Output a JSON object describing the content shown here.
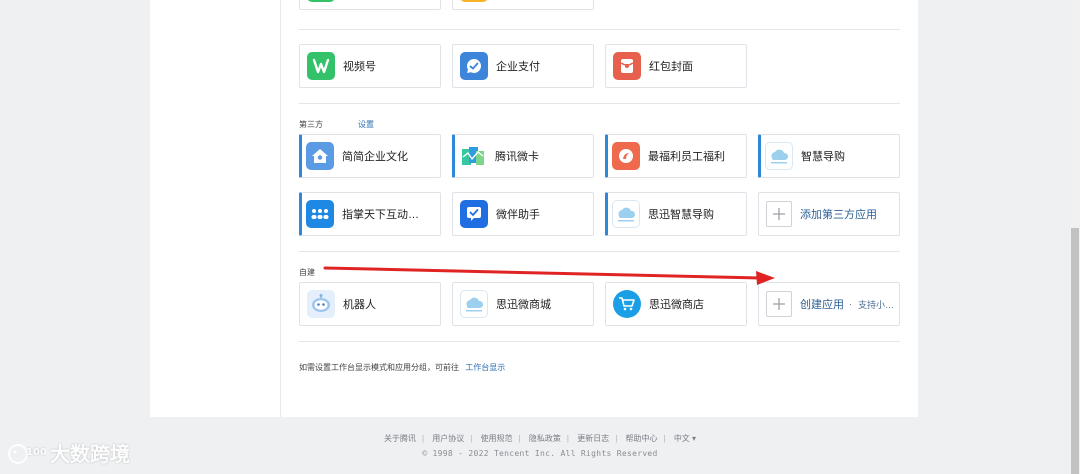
{
  "sections": {
    "row_top": {
      "items": [
        {
          "label": "视频号",
          "icon": "channels-icon",
          "color": "#33c26a"
        },
        {
          "label": "企业支付",
          "icon": "payment-icon",
          "color": "#3d85da"
        },
        {
          "label": "红包封面",
          "icon": "red-packet-icon",
          "color": "#e6604d"
        }
      ]
    },
    "third_party": {
      "title": "第三方",
      "settings_link": "设置",
      "items": [
        {
          "label": "简简企业文化",
          "icon": "house-icon",
          "color": "#5a9be3"
        },
        {
          "label": "腾讯微卡",
          "icon": "card-icon",
          "color": "#37c7a2"
        },
        {
          "label": "最福利员工福利",
          "icon": "welfare-icon",
          "color": "#ef6a4d"
        },
        {
          "label": "智慧导购",
          "icon": "cloud-shop-icon",
          "color": "#67b6e3"
        },
        {
          "label": "指掌天下互动…",
          "icon": "people-icon",
          "color": "#1e88e5"
        },
        {
          "label": "微伴助手",
          "icon": "check-chat-icon",
          "color": "#1f6fe3"
        },
        {
          "label": "思迅智慧导购",
          "icon": "cloud-shop-icon",
          "color": "#67b6e3"
        }
      ],
      "add_label": "添加第三方应用"
    },
    "custom": {
      "title": "自建",
      "items": [
        {
          "label": "机器人",
          "icon": "robot-icon",
          "color": "#7fb3e6"
        },
        {
          "label": "思迅微商城",
          "icon": "cloud-shop-icon",
          "color": "#67b6e3"
        },
        {
          "label": "思迅微商店",
          "icon": "cart-icon",
          "color": "#1a9fe6"
        }
      ],
      "create_label": "创建应用",
      "create_dot": "·",
      "create_sub": "支持小…"
    },
    "hint": {
      "text": "如需设置工作台显示模式和应用分组，可前往",
      "link": "工作台显示"
    }
  },
  "footer": {
    "links": [
      "关于腾讯",
      "用户协议",
      "使用规范",
      "隐私政策",
      "更新日志",
      "帮助中心",
      "中文 ▾"
    ],
    "separator": "|",
    "copyright": "© 1998 - 2022 Tencent Inc. All Rights Reserved"
  },
  "watermark": {
    "text": "大数跨境",
    "logo": "dashuju-logo"
  },
  "annotation": {
    "arrow_color": "#e02424"
  }
}
